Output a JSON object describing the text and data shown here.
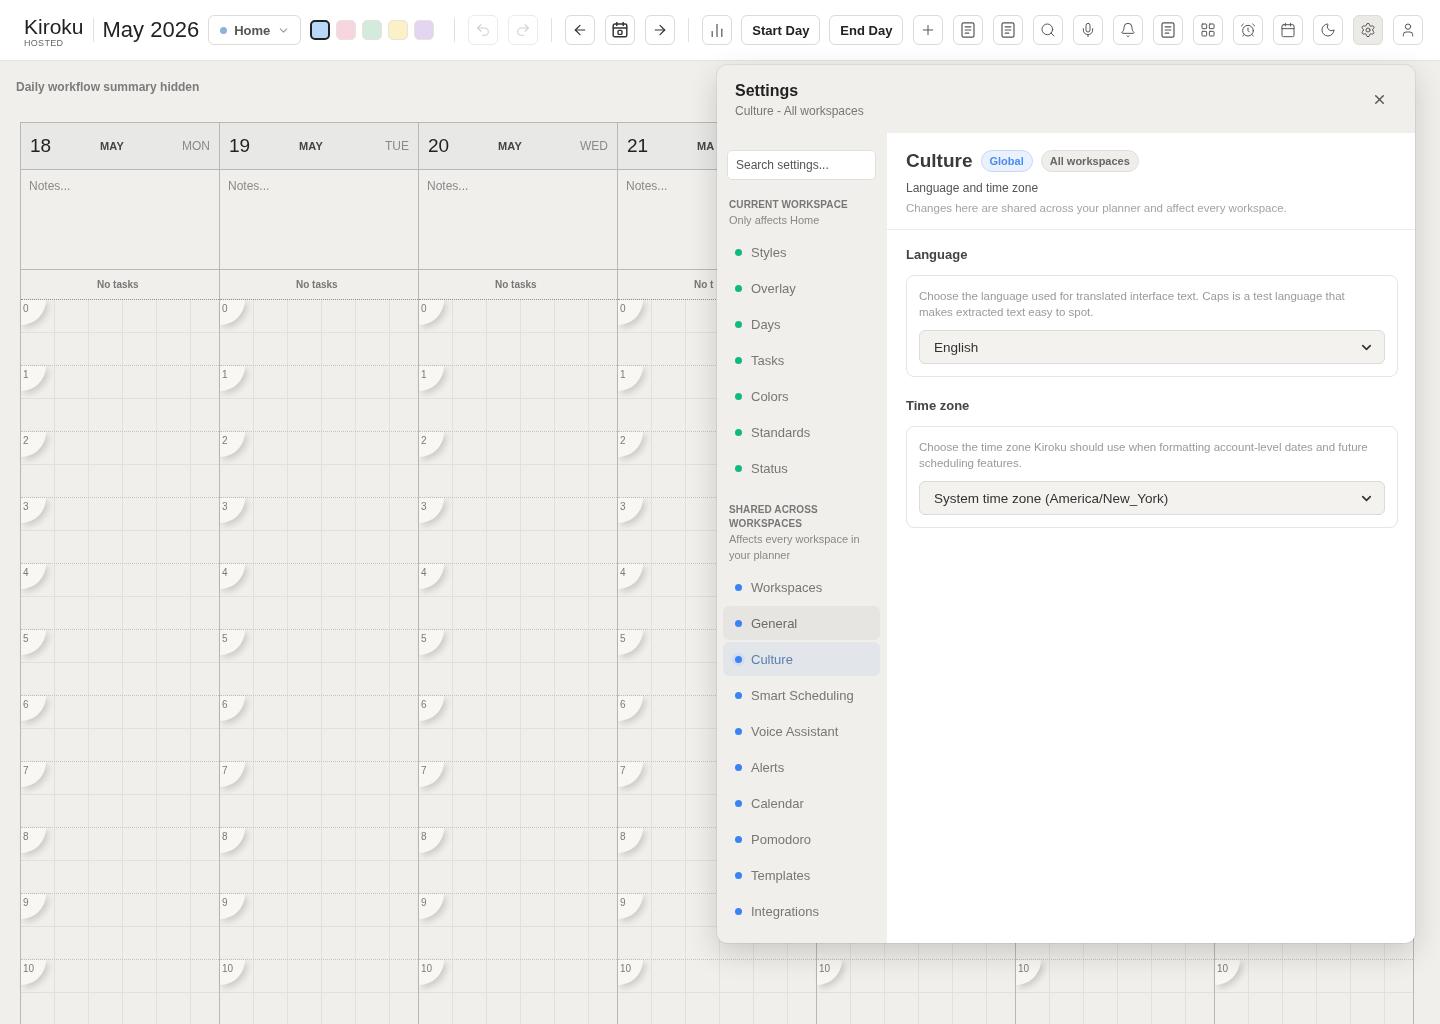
{
  "toolbar": {
    "logo": "Kiroku",
    "logo_badge": "HOSTED",
    "title": "May 2026",
    "workspace_menu": {
      "label": "Home"
    },
    "swatches": [
      {
        "color": "#b9d8f7",
        "selected": true
      },
      {
        "color": "#f7d6df",
        "selected": false
      },
      {
        "color": "#d4ebdb",
        "selected": false
      },
      {
        "color": "#fcf0c7",
        "selected": false
      },
      {
        "color": "#e2d6f0",
        "selected": false
      }
    ],
    "history": [
      {
        "kind": "undo",
        "disabled": true
      },
      {
        "kind": "redo",
        "disabled": true
      }
    ],
    "navigation": [
      {
        "kind": "previous"
      },
      {
        "kind": "today"
      },
      {
        "kind": "next"
      }
    ],
    "actions": [
      {
        "kind": "stats",
        "active": false
      },
      {
        "kind": "start",
        "label": "Start Day",
        "active": false
      },
      {
        "kind": "end",
        "label": "End Day",
        "active": false
      },
      {
        "kind": "add",
        "active": false
      },
      {
        "kind": "notes",
        "active": false
      },
      {
        "kind": "journal",
        "active": false
      },
      {
        "kind": "search",
        "active": false
      },
      {
        "kind": "voice",
        "active": false
      },
      {
        "kind": "alerts",
        "active": false
      },
      {
        "kind": "summary",
        "active": false
      },
      {
        "kind": "apps",
        "active": false
      },
      {
        "kind": "pomodoro",
        "active": false
      },
      {
        "kind": "calendar",
        "active": false
      },
      {
        "kind": "theme",
        "active": false
      },
      {
        "kind": "settings",
        "active": true
      },
      {
        "kind": "profile",
        "active": false
      }
    ]
  },
  "summary_toggle": "Daily workflow summary hidden",
  "calendar": {
    "days": [
      {
        "date": "18",
        "month": "MAY",
        "weekday": "MON",
        "notes_placeholder": "Notes...",
        "tasks": "No tasks"
      },
      {
        "date": "19",
        "month": "MAY",
        "weekday": "TUE",
        "notes_placeholder": "Notes...",
        "tasks": "No tasks"
      },
      {
        "date": "20",
        "month": "MAY",
        "weekday": "WED",
        "notes_placeholder": "Notes...",
        "tasks": "No tasks"
      },
      {
        "date": "21",
        "month": "MA",
        "notes_placeholder": "Notes...",
        "tasks": "No t"
      }
    ],
    "hour_rows": [
      {
        "labels": [
          "0",
          "0",
          "0",
          "0"
        ]
      },
      {
        "labels": [
          "1",
          "1",
          "1",
          "1"
        ]
      },
      {
        "labels": [
          "2",
          "2",
          "2",
          "2"
        ]
      },
      {
        "labels": [
          "3",
          "3",
          "3",
          "3"
        ]
      },
      {
        "labels": [
          "4",
          "4",
          "4",
          "4"
        ]
      },
      {
        "labels": [
          "5",
          "5",
          "5",
          "5"
        ]
      },
      {
        "labels": [
          "6",
          "6",
          "6",
          "6"
        ]
      },
      {
        "labels": [
          "7",
          "7",
          "7",
          "7"
        ]
      },
      {
        "labels": [
          "8",
          "8",
          "8",
          "8"
        ]
      },
      {
        "labels": [
          "9",
          "9",
          "9",
          "9"
        ]
      },
      {
        "labels": [
          "10",
          "10",
          "10",
          "10",
          "10",
          "10",
          "10"
        ]
      }
    ]
  },
  "settings": {
    "title": "Settings",
    "subtitle": "Culture - All workspaces",
    "search_placeholder": "Search settings...",
    "groups": [
      {
        "heading": "CURRENT WORKSPACE",
        "note": "Only affects Home",
        "items": [
          {
            "label": "Styles",
            "color": "#10b981",
            "selected": false,
            "hovered": false
          },
          {
            "label": "Overlay",
            "color": "#10b981",
            "selected": false,
            "hovered": false
          },
          {
            "label": "Days",
            "color": "#10b981",
            "selected": false,
            "hovered": false
          },
          {
            "label": "Tasks",
            "color": "#10b981",
            "selected": false,
            "hovered": false
          },
          {
            "label": "Colors",
            "color": "#10b981",
            "selected": false,
            "hovered": false
          },
          {
            "label": "Standards",
            "color": "#10b981",
            "selected": false,
            "hovered": false
          },
          {
            "label": "Status",
            "color": "#10b981",
            "selected": false,
            "hovered": false
          }
        ]
      },
      {
        "heading": "SHARED ACROSS WORKSPACES",
        "note": "Affects every workspace in your planner",
        "items": [
          {
            "label": "Workspaces",
            "color": "#3b82f6",
            "selected": false,
            "hovered": false
          },
          {
            "label": "General",
            "color": "#3b82f6",
            "selected": false,
            "hovered": true
          },
          {
            "label": "Culture",
            "color": "#3b82f6",
            "selected": true,
            "hovered": false
          },
          {
            "label": "Smart Scheduling",
            "color": "#3b82f6",
            "selected": false,
            "hovered": false
          },
          {
            "label": "Voice Assistant",
            "color": "#3b82f6",
            "selected": false,
            "hovered": false
          },
          {
            "label": "Alerts",
            "color": "#3b82f6",
            "selected": false,
            "hovered": false
          },
          {
            "label": "Calendar",
            "color": "#3b82f6",
            "selected": false,
            "hovered": false
          },
          {
            "label": "Pomodoro",
            "color": "#3b82f6",
            "selected": false,
            "hovered": false
          },
          {
            "label": "Templates",
            "color": "#3b82f6",
            "selected": false,
            "hovered": false
          },
          {
            "label": "Integrations",
            "color": "#3b82f6",
            "selected": false,
            "hovered": false
          }
        ]
      }
    ],
    "section": {
      "title": "Culture",
      "badges": [
        {
          "label": "Global",
          "kind": "accent"
        },
        {
          "label": "All workspaces",
          "kind": "neutral"
        }
      ],
      "subtitle": "Language and time zone",
      "description": "Changes here are shared across your planner and affect every workspace."
    },
    "fields": [
      {
        "label": "Language",
        "description": "Choose the language used for translated interface text. Caps is a test language that makes extracted text easy to spot.",
        "value": "English"
      },
      {
        "label": "Time zone",
        "description": "Choose the time zone Kiroku should use when formatting account-level dates and future scheduling features.",
        "value": "System time zone (America/New_York)"
      }
    ]
  }
}
